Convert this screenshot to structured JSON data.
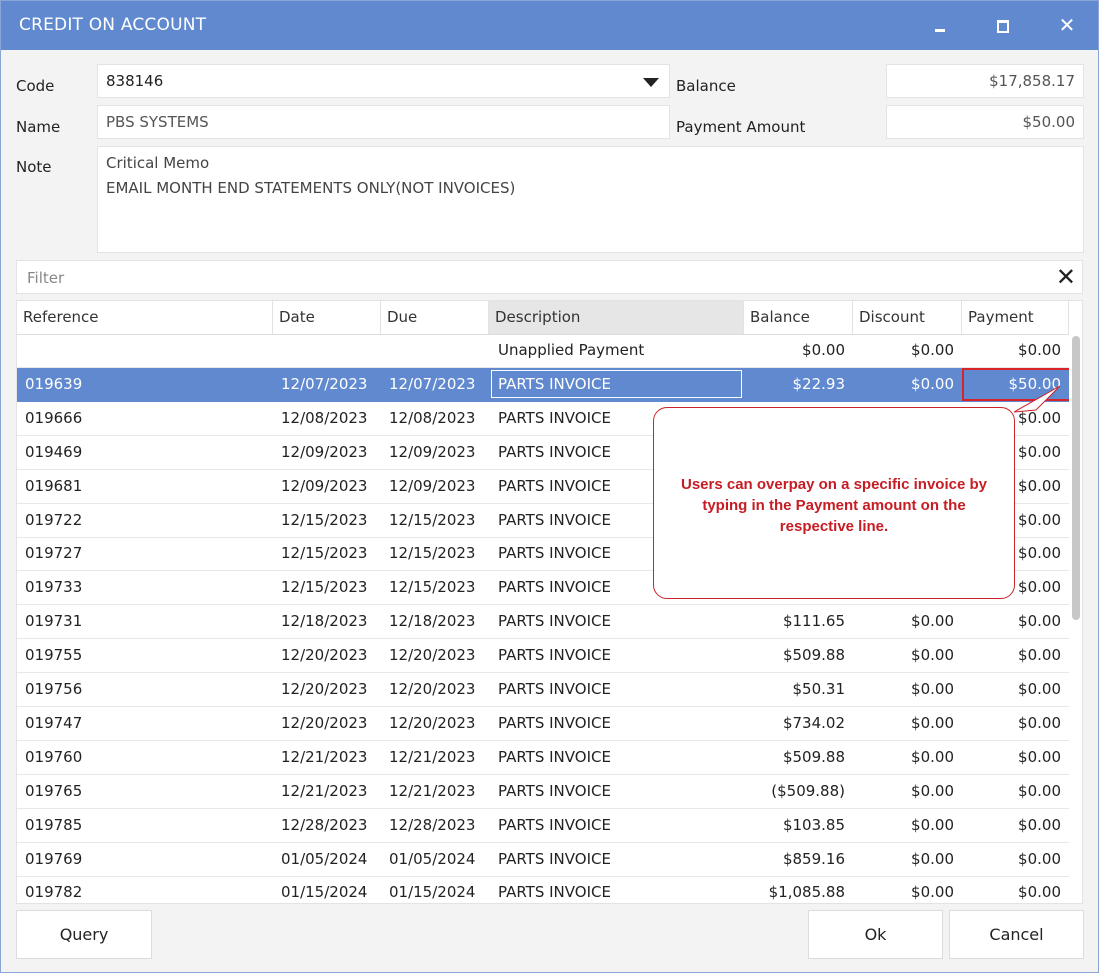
{
  "window": {
    "title": "CREDIT ON ACCOUNT",
    "controls": [
      "minimize-icon",
      "maximize-icon",
      "close-icon"
    ]
  },
  "form": {
    "code_label": "Code",
    "code_value": "838146",
    "name_label": "Name",
    "name_value": "PBS SYSTEMS",
    "note_label": "Note",
    "note_lines": [
      "Critical Memo",
      "EMAIL MONTH END STATEMENTS ONLY(NOT INVOICES)"
    ],
    "balance_label": "Balance",
    "balance_value": "$17,858.17",
    "payment_label": "Payment Amount",
    "payment_value": "$50.00"
  },
  "filter": {
    "placeholder": "Filter"
  },
  "table": {
    "columns": [
      "Reference",
      "Date",
      "Due",
      "Description",
      "Balance",
      "Discount",
      "Payment"
    ],
    "sorted_column": "Description",
    "selected_row": 1,
    "rows": [
      [
        "",
        "",
        "",
        "Unapplied Payment",
        "$0.00",
        "$0.00",
        "$0.00"
      ],
      [
        "019639",
        "12/07/2023",
        "12/07/2023",
        "PARTS INVOICE",
        "$22.93",
        "$0.00",
        "$50.00"
      ],
      [
        "019666",
        "12/08/2023",
        "12/08/2023",
        "PARTS INVOICE",
        "",
        "",
        "$0.00"
      ],
      [
        "019469",
        "12/09/2023",
        "12/09/2023",
        "PARTS INVOICE",
        "",
        "",
        "$0.00"
      ],
      [
        "019681",
        "12/09/2023",
        "12/09/2023",
        "PARTS INVOICE",
        "",
        "",
        "$0.00"
      ],
      [
        "019722",
        "12/15/2023",
        "12/15/2023",
        "PARTS INVOICE",
        "",
        "",
        "$0.00"
      ],
      [
        "019727",
        "12/15/2023",
        "12/15/2023",
        "PARTS INVOICE",
        "",
        "",
        "$0.00"
      ],
      [
        "019733",
        "12/15/2023",
        "12/15/2023",
        "PARTS INVOICE",
        "",
        "",
        "$0.00"
      ],
      [
        "019731",
        "12/18/2023",
        "12/18/2023",
        "PARTS INVOICE",
        "$111.65",
        "$0.00",
        "$0.00"
      ],
      [
        "019755",
        "12/20/2023",
        "12/20/2023",
        "PARTS INVOICE",
        "$509.88",
        "$0.00",
        "$0.00"
      ],
      [
        "019756",
        "12/20/2023",
        "12/20/2023",
        "PARTS INVOICE",
        "$50.31",
        "$0.00",
        "$0.00"
      ],
      [
        "019747",
        "12/20/2023",
        "12/20/2023",
        "PARTS INVOICE",
        "$734.02",
        "$0.00",
        "$0.00"
      ],
      [
        "019760",
        "12/21/2023",
        "12/21/2023",
        "PARTS INVOICE",
        "$509.88",
        "$0.00",
        "$0.00"
      ],
      [
        "019765",
        "12/21/2023",
        "12/21/2023",
        "PARTS INVOICE",
        "($509.88)",
        "$0.00",
        "$0.00"
      ],
      [
        "019785",
        "12/28/2023",
        "12/28/2023",
        "PARTS INVOICE",
        "$103.85",
        "$0.00",
        "$0.00"
      ],
      [
        "019769",
        "01/05/2024",
        "01/05/2024",
        "PARTS INVOICE",
        "$859.16",
        "$0.00",
        "$0.00"
      ],
      [
        "019782",
        "01/15/2024",
        "01/15/2024",
        "PARTS INVOICE",
        "$1,085.88",
        "$0.00",
        "$0.00"
      ]
    ]
  },
  "callout": {
    "text": "Users can overpay on a specific invoice by typing in the Payment amount on the respective line."
  },
  "buttons": {
    "query": "Query",
    "ok": "Ok",
    "cancel": "Cancel"
  },
  "colors": {
    "titlebar": "#6089cf",
    "selected_row": "#6089cf",
    "callout": "#c61d24"
  }
}
